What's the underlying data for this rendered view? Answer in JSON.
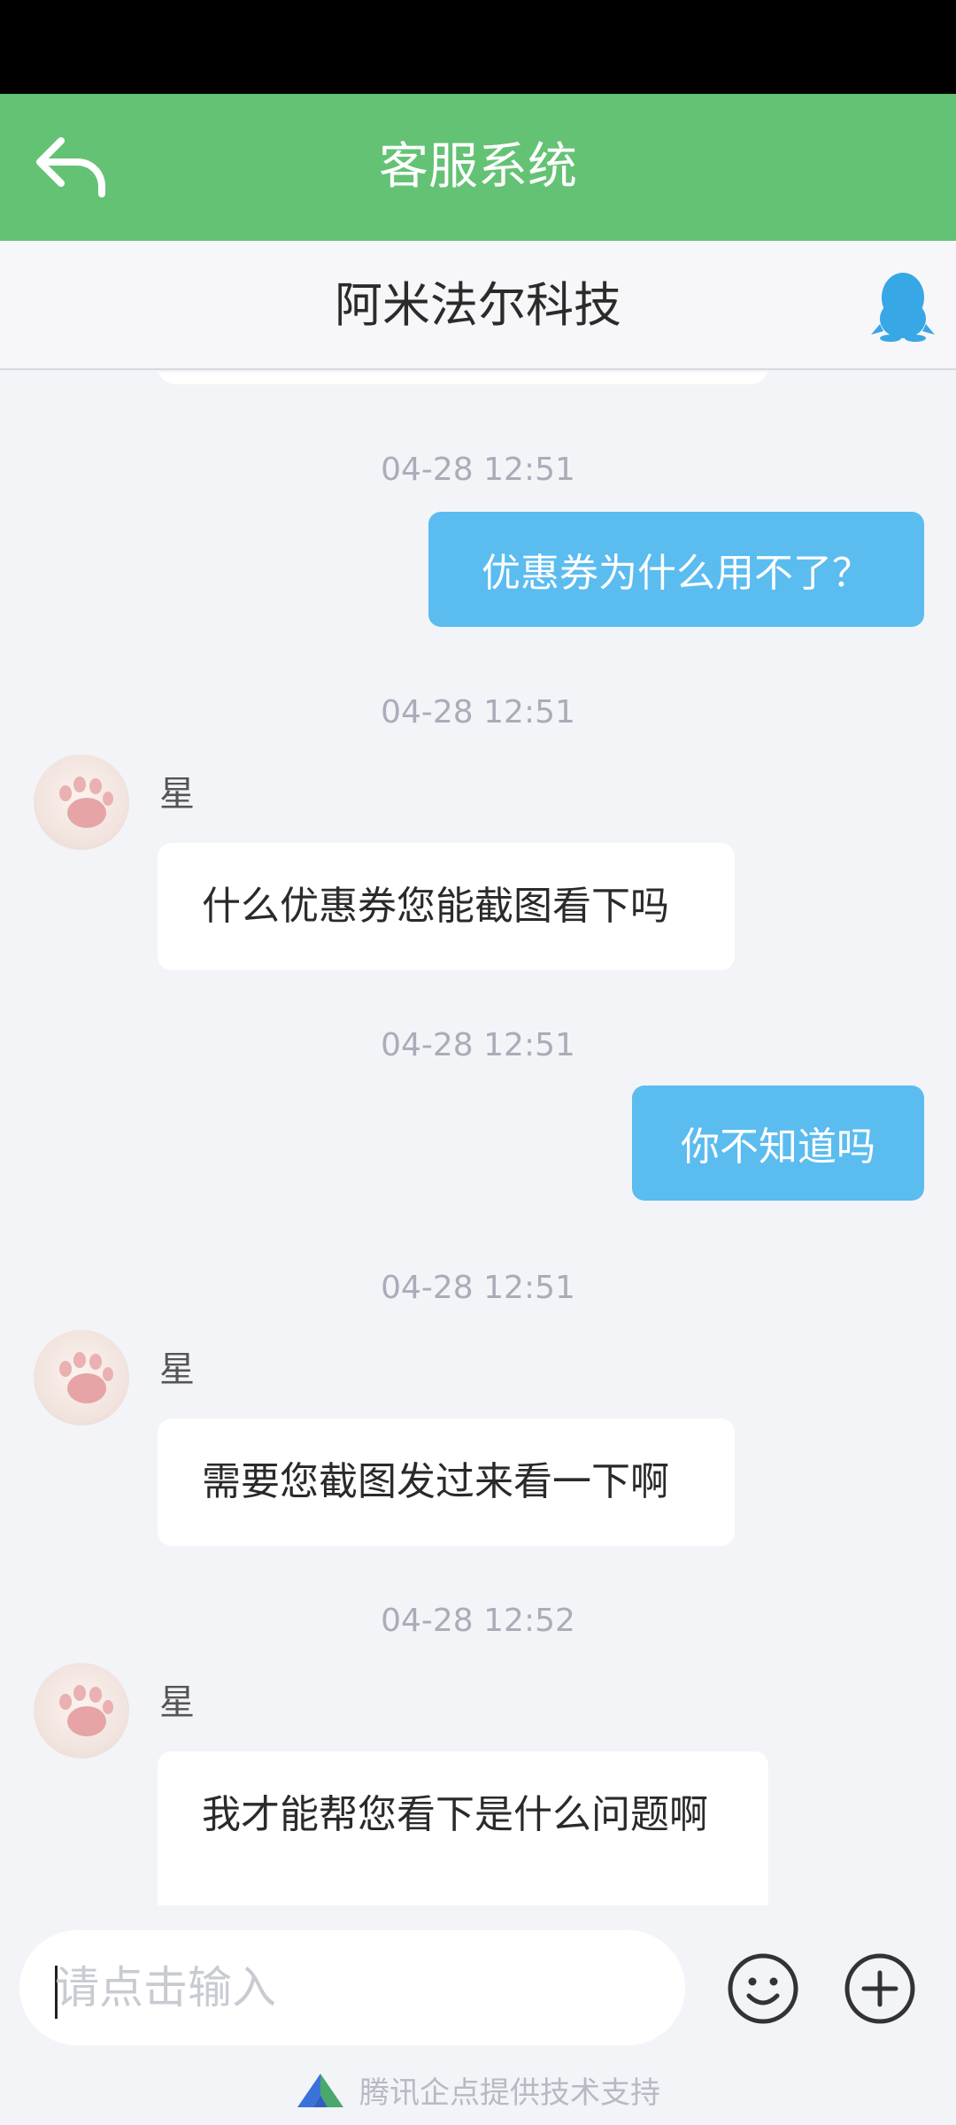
{
  "header": {
    "title": "客服系统",
    "back_icon": "back-arrow-icon"
  },
  "sub_header": {
    "company": "阿米法尔科技",
    "qq_icon": "qq-penguin-icon"
  },
  "messages": [
    {
      "time": "04-28 12:51",
      "from": "me",
      "text": "优惠券为什么用不了？"
    },
    {
      "time": "04-28 12:51",
      "from": "agent",
      "name": "星",
      "text": "什么优惠券您能截图看下吗"
    },
    {
      "time": "04-28 12:51",
      "from": "me",
      "text": "你不知道吗"
    },
    {
      "time": "04-28 12:51",
      "from": "agent",
      "name": "星",
      "text": "需要您截图发过来看一下啊"
    },
    {
      "time": "04-28 12:52",
      "from": "agent",
      "name": "星",
      "text": "我才能帮您看下是什么问题啊"
    }
  ],
  "input": {
    "placeholder": "请点击输入",
    "emoji_icon": "smiley-icon",
    "plus_icon": "plus-icon"
  },
  "footer": {
    "powered_by": "腾讯企点提供技术支持"
  },
  "colors": {
    "header": "#64c274",
    "outgoing_bubble": "#5bbcef",
    "background": "#f3f4f8"
  }
}
